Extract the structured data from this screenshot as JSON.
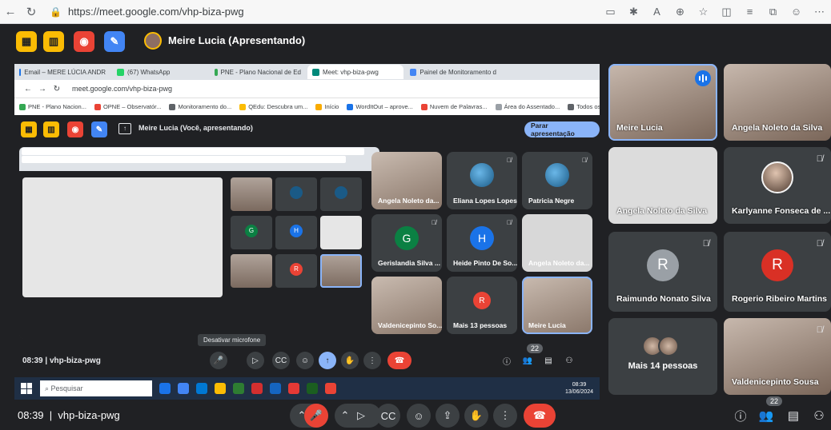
{
  "browser": {
    "url": "https://meet.google.com/vhp-biza-pwg"
  },
  "meet_top": {
    "presenter": "Meire Lucia (Apresentando)"
  },
  "shared_screen": {
    "tabs": [
      {
        "label": "Email – MERE LÚCIA ANDR",
        "color": "#1a73e8"
      },
      {
        "label": "(67) WhatsApp",
        "color": "#25d366"
      },
      {
        "label": "PNE - Plano Nacional de Ed",
        "color": "#34a853"
      },
      {
        "label": "Meet: vhp-biza-pwg",
        "color": "#00897b"
      },
      {
        "label": "Painel de Monitoramento d",
        "color": "#4285f4"
      }
    ],
    "address": "meet.google.com/vhp-biza-pwg",
    "bookmarks": [
      {
        "label": "PNE - Plano Nacion...",
        "color": "#34a853"
      },
      {
        "label": "OPNE – Observatór...",
        "color": "#ea4335"
      },
      {
        "label": "Monitoramento do...",
        "color": "#5f6368"
      },
      {
        "label": "QEdu: Descubra um...",
        "color": "#fbbc04"
      },
      {
        "label": "Início",
        "color": "#f9ab00"
      },
      {
        "label": "WordItOut – aprove...",
        "color": "#1a73e8"
      },
      {
        "label": "Nuvem de Palavras...",
        "color": "#ea4335"
      },
      {
        "label": "Área do Assentado...",
        "color": "#9aa0a6"
      },
      {
        "label": "Todos os favoritos",
        "color": "#5f6368"
      }
    ],
    "presenting_text": "Meire Lucia (Você, apresentando)",
    "stop_button": "Parar apresentação",
    "tiles": [
      {
        "name": "Angela Noleto da..."
      },
      {
        "name": "Eliana Lopes Lopes"
      },
      {
        "name": "Patricia Negre"
      },
      {
        "name": "Gerislandia Silva ...",
        "initial": "G",
        "color": "#0b8043"
      },
      {
        "name": "Heide Pinto De So...",
        "initial": "H",
        "color": "#1a73e8"
      },
      {
        "name": "Angela Noleto da..."
      },
      {
        "name": "Valdenicepinto So..."
      },
      {
        "name": "Mais 13 pessoas"
      },
      {
        "name": "Meire Lucia"
      }
    ],
    "clock": "08:39",
    "meeting_code": "vhp-biza-pwg",
    "tooltip": "Desativar microfone",
    "taskbar_search": "Pesquisar",
    "tray_time": "08:39",
    "tray_date": "13/06/2024",
    "participant_badge": "22"
  },
  "participants": [
    {
      "name": "Meire Lucia",
      "type": "face",
      "speaking": true
    },
    {
      "name": "Angela Noleto da Silva",
      "type": "face"
    },
    {
      "name": "Angela Noleto da Silva",
      "type": "screen"
    },
    {
      "name": "Karlyanne Fonseca de ...",
      "type": "photo"
    },
    {
      "name": "Raimundo Nonato Silva",
      "initial": "R",
      "color": "#9aa0a6"
    },
    {
      "name": "Rogerio Ribeiro Martins",
      "initial": "R",
      "color": "#d93025"
    },
    {
      "name": "Mais 14 pessoas",
      "type": "more"
    },
    {
      "name": "Valdenicepinto Sousa",
      "type": "face"
    }
  ],
  "bottom_bar": {
    "clock": "08:39",
    "meeting_code": "vhp-biza-pwg",
    "participant_count": "22"
  },
  "colors": {
    "background": "#202124",
    "tile": "#3c4043",
    "hangup": "#ea4335",
    "accent": "#8ab4f8"
  },
  "icons": [
    "mic-off-icon",
    "camera-icon",
    "captions-icon",
    "emoji-icon",
    "present-icon",
    "raise-hand-icon",
    "more-options-icon",
    "hangup-icon",
    "info-icon",
    "people-icon",
    "chat-icon",
    "activities-icon"
  ]
}
